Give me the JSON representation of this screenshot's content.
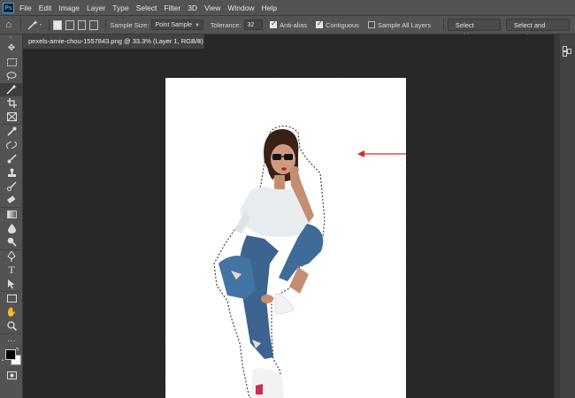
{
  "app": {
    "logo_text": "Ps",
    "menu": [
      "File",
      "Edit",
      "Image",
      "Layer",
      "Type",
      "Select",
      "Filter",
      "3D",
      "View",
      "Window",
      "Help"
    ]
  },
  "options_bar": {
    "sample_size_label": "Sample Size:",
    "sample_size_value": "Point Sample",
    "tolerance_label": "Tolerance:",
    "tolerance_value": "32",
    "anti_alias": {
      "label": "Anti-alias",
      "checked": true
    },
    "contiguous": {
      "label": "Contiguous",
      "checked": true
    },
    "sample_all_layers": {
      "label": "Sample All Layers",
      "checked": false
    },
    "select_subject_label": "Select Subject",
    "select_and_mask_label": "Select and Mask..."
  },
  "document": {
    "tab_title": "pexels-arnie-chou-1557843.png @ 33.3% (Layer 1, RGB/8)",
    "close_glyph": "×"
  },
  "tools": [
    "move-tool",
    "marquee-tool",
    "lasso-tool",
    "magic-wand-tool",
    "crop-tool",
    "frame-tool",
    "eyedropper-tool",
    "healing-brush-tool",
    "brush-tool",
    "clone-stamp-tool",
    "history-brush-tool",
    "eraser-tool",
    "gradient-tool",
    "blur-tool",
    "dodge-tool",
    "pen-tool",
    "type-tool",
    "path-selection-tool",
    "rectangle-tool",
    "hand-tool",
    "zoom-tool",
    "more-tools"
  ],
  "active_tool": "magic-wand-tool",
  "colors": {
    "foreground": "#000000",
    "background": "#ffffff",
    "annotation_arrow": "#e32424"
  }
}
